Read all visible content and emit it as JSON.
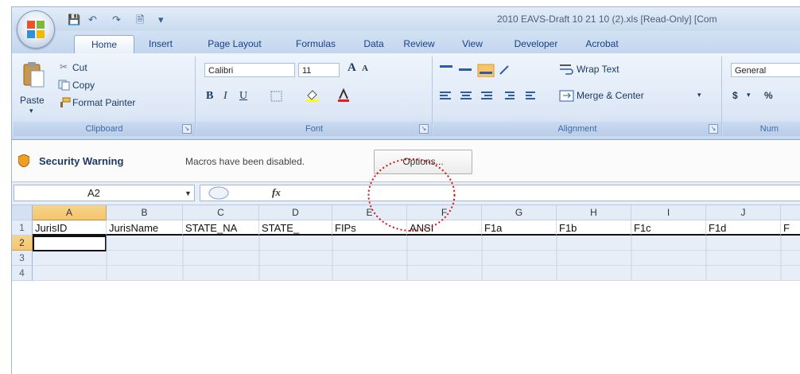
{
  "window": {
    "title": "2010 EAVS-Draft 10 21 10 (2).xls  [Read-Only]  [Com"
  },
  "quick_access": {
    "items": [
      "save-icon",
      "undo-icon",
      "redo-icon",
      "print-preview-icon",
      "customize-icon"
    ]
  },
  "tabs": [
    "Home",
    "Insert",
    "Page Layout",
    "Formulas",
    "Data",
    "Review",
    "View",
    "Developer",
    "Acrobat"
  ],
  "active_tab": "Home",
  "ribbon": {
    "clipboard": {
      "label": "Clipboard",
      "paste": "Paste",
      "cut": "Cut",
      "copy": "Copy",
      "format_painter": "Format Painter"
    },
    "font": {
      "label": "Font",
      "font_name": "Calibri",
      "font_size": "11",
      "bold": "B",
      "italic": "I",
      "underline": "U",
      "grow": "A",
      "shrink": "A"
    },
    "alignment": {
      "label": "Alignment",
      "wrap_text": "Wrap Text",
      "merge_center": "Merge & Center"
    },
    "number": {
      "label": "Num",
      "format": "General",
      "currency": "$",
      "percent": "%"
    }
  },
  "security_bar": {
    "title": "Security Warning",
    "message": "Macros have been disabled.",
    "options_label": "Options..."
  },
  "formula_bar": {
    "name_box": "A2",
    "fx": "fx"
  },
  "grid": {
    "columns": [
      "A",
      "B",
      "C",
      "D",
      "E",
      "F",
      "G",
      "H",
      "I",
      "J"
    ],
    "rows": [
      "1",
      "2",
      "3",
      "4"
    ],
    "row1": [
      "JurisID",
      "JurisName",
      "STATE_NA",
      "STATE_",
      "FIPs",
      "ANSI",
      "F1a",
      "F1b",
      "F1c",
      "F1d"
    ]
  },
  "colors": {
    "accent": "#15428b",
    "header_highlight": "#f9c46a",
    "annotation": "#dd1010"
  }
}
